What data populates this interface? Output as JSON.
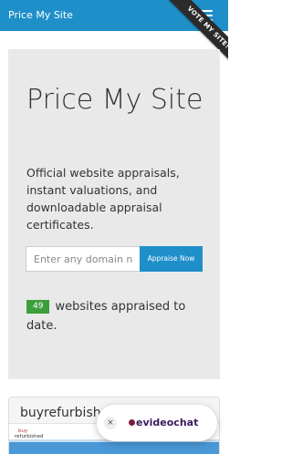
{
  "navbar": {
    "brand": "Price My Site",
    "ribbon": "VOTE MY SITE!"
  },
  "hero": {
    "title": "Price My Site",
    "lead": "Official website appraisals, instant valuations, and downloadable appraisal certificates.",
    "search": {
      "placeholder": "Enter any domain name",
      "button_label": "Appraise Now"
    },
    "count": {
      "value": "49",
      "suffix": "websites appraised to date."
    }
  },
  "card": {
    "title": "buyrefurbished.com",
    "thumb_logo_top": "buy",
    "thumb_logo_bottom": "refurbished"
  },
  "chat": {
    "close": "×",
    "brand": "evideochat"
  },
  "colors": {
    "primary": "#1f8fc9",
    "badge": "#3c9f3c",
    "ribbon": "#2b2b2b"
  }
}
